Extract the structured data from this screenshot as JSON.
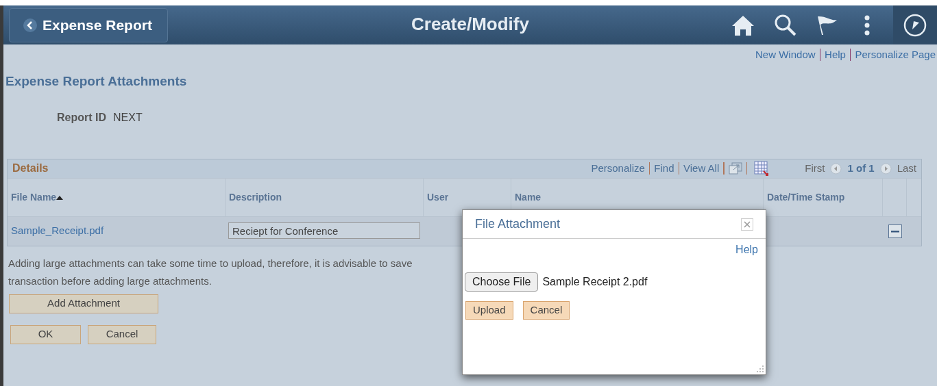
{
  "header": {
    "back_button": "Expense Report",
    "title": "Create/Modify"
  },
  "links": [
    "New Window",
    "Help",
    "Personalize Page"
  ],
  "page_title": "Expense Report Attachments",
  "report_id": {
    "label": "Report ID",
    "value": "NEXT"
  },
  "grid": {
    "title": "Details",
    "toolbar": [
      "Personalize",
      "Find",
      "View All"
    ],
    "pager": {
      "first": "First",
      "range": "1 of 1",
      "last": "Last"
    },
    "columns": [
      {
        "label": "File Name",
        "sorted": true
      },
      {
        "label": "Description",
        "sorted": false
      },
      {
        "label": "User",
        "sorted": false
      },
      {
        "label": "Name",
        "sorted": false
      },
      {
        "label": "Date/Time Stamp",
        "sorted": false
      }
    ],
    "rows": [
      {
        "file_name": "Sample_Receipt.pdf",
        "description": "Reciept for Conference"
      }
    ]
  },
  "notice": [
    "Adding large attachments can take some time to upload, therefore, it is advisable to save",
    "transaction before adding large attachments."
  ],
  "add_button": "Add Attachment",
  "buttons": [
    "OK",
    "Cancel"
  ],
  "dialog": {
    "title": "File Attachment",
    "help": "Help",
    "choose_button": "Choose File",
    "file_name": "Sample Receipt 2.pdf",
    "buttons": [
      "Upload",
      "Cancel"
    ]
  }
}
